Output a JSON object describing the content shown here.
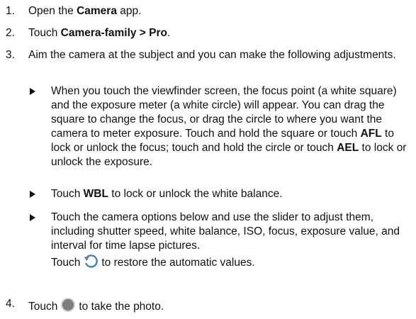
{
  "steps": [
    {
      "num": "1.",
      "pre": "Open the ",
      "bold": "Camera",
      "post": " app."
    },
    {
      "num": "2.",
      "pre": "Touch ",
      "bold": "Camera-family > Pro",
      "post": "."
    },
    {
      "num": "3.",
      "text": "Aim the camera at the subject and you can make the following adjustments."
    },
    {
      "num": "4.",
      "pre": "Touch",
      "post": "to take the photo."
    }
  ],
  "bullets": [
    {
      "text_a": "When you touch the viewfinder screen, the focus point (a white square) and the exposure meter (a white circle) will appear. You can drag the square to change the focus, or drag the circle to where you want the camera to meter exposure. Touch and hold the square or touch ",
      "bold_a": "AFL",
      "text_b": " to lock or unlock the focus; touch and hold the circle or touch ",
      "bold_b": "AEL",
      "text_c": " to lock or unlock the exposure."
    },
    {
      "pre": "Touch ",
      "bold": "WBL",
      "post": " to lock or unlock the white balance."
    },
    {
      "text": "Touch the camera options below and use the slider to adjust them, including shutter speed, white balance, ISO, focus, exposure value, and interval for time lapse pictures.",
      "pre_icon": "Touch",
      "post_icon": "to restore the automatic values."
    }
  ],
  "icons": {
    "restore": "restore-icon",
    "shutter": "shutter-button-icon",
    "bullet": "bullet-arrow-icon",
    "icon_color": "#4a7fb3",
    "shutter_color": "#7d7d7d"
  }
}
